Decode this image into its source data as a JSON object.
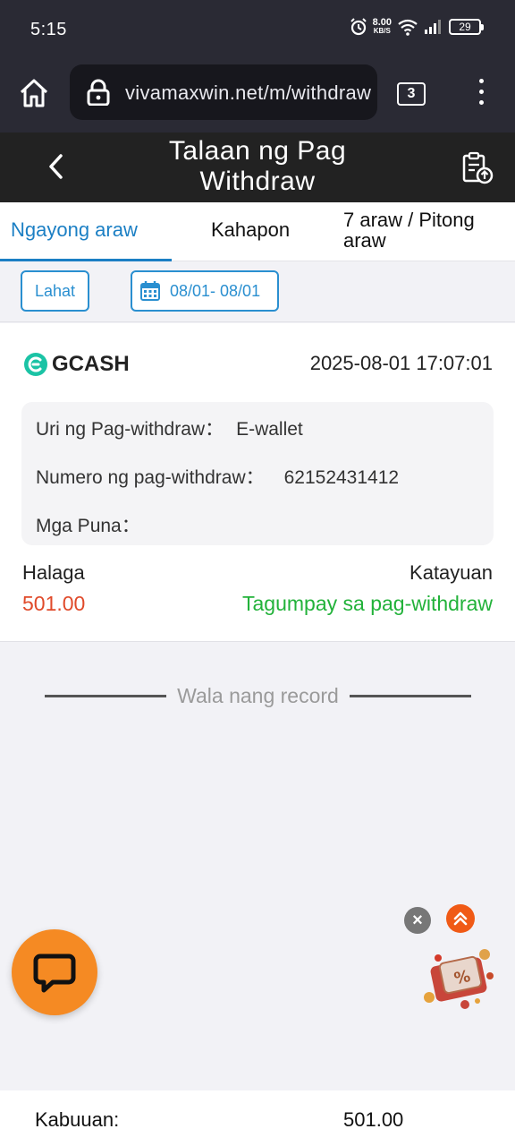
{
  "status_bar": {
    "time": "5:15",
    "net_speed": "8.00",
    "net_unit": "KB/S",
    "battery": "29"
  },
  "browser": {
    "url": "vivamaxwin.net/m/withdraw",
    "tab_count": "3"
  },
  "header": {
    "title": "Talaan ng Pag Withdraw"
  },
  "tabs": [
    {
      "label": "Ngayong araw",
      "active": true
    },
    {
      "label": "Kahapon",
      "active": false
    },
    {
      "label": "7 araw / Pitong araw",
      "active": false
    }
  ],
  "filters": {
    "all_label": "Lahat",
    "date_range": "08/01- 08/01"
  },
  "record": {
    "method": "GCASH",
    "datetime": "2025-08-01 17:07:01",
    "type_label": "Uri ng Pag-withdraw：",
    "type_value": "E-wallet",
    "number_label": "Numero ng pag-withdraw：",
    "number_value": "62152431412",
    "remarks_label": "Mga Puna：",
    "remarks_value": "",
    "amount_label": "Halaga",
    "amount_value": "501.00",
    "status_label": "Katayuan",
    "status_value": "Tagumpay sa pag-withdraw"
  },
  "no_more_text": "Wala nang record",
  "total": {
    "label": "Kabuuan:",
    "value": "501.00"
  },
  "colors": {
    "accent": "#1b7fc4",
    "amount": "#e04a2a",
    "success": "#22b23a",
    "chat": "#f58a23"
  }
}
